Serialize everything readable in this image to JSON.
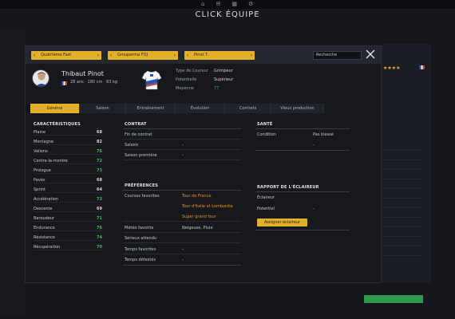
{
  "app": {
    "title": "CLICK ÉQUIPE"
  },
  "top_icons": [
    "home-icon",
    "mail-icon",
    "calendar-icon",
    "settings-icon"
  ],
  "background": {
    "stars": "★★★★"
  },
  "modal": {
    "nav": [
      {
        "label": "Quatrième Fast",
        "name": "nav-prev-team"
      },
      {
        "label": "Grouperma FDJ",
        "name": "nav-team"
      },
      {
        "label": "Pinot T.",
        "name": "nav-rider"
      }
    ],
    "search": {
      "value": "Recherche"
    }
  },
  "rider": {
    "name": "Thibaut Pinot",
    "stats": "28 ans · 180 cm · 63 kg",
    "info": [
      {
        "label": "Type de Coureur",
        "value": "Grimpeur"
      },
      {
        "label": "Potentielle",
        "value": "Supérieur"
      },
      {
        "label": "Moyenne",
        "value": "77"
      }
    ]
  },
  "tabs": [
    {
      "label": "Général",
      "active": true
    },
    {
      "label": "Saison",
      "active": false
    },
    {
      "label": "Entraînement",
      "active": false
    },
    {
      "label": "Évolution",
      "active": false
    },
    {
      "label": "Contrats",
      "active": false
    },
    {
      "label": "Vieux production",
      "active": false
    }
  ],
  "characteristics": {
    "title": "CARACTÉRISTIQUES",
    "items": [
      {
        "name": "Plaine",
        "value": "68",
        "color": "#d6d8dc"
      },
      {
        "name": "Montagne",
        "value": "82",
        "color": "#d6d8dc"
      },
      {
        "name": "Vallons",
        "value": "76",
        "color": "#3fbf5b"
      },
      {
        "name": "Contre-la-montre",
        "value": "72",
        "color": "#3fbf5b"
      },
      {
        "name": "Prologue",
        "value": "73",
        "color": "#3fbf5b"
      },
      {
        "name": "Pavés",
        "value": "68",
        "color": "#d6d8dc"
      },
      {
        "name": "Sprint",
        "value": "64",
        "color": "#d6d8dc"
      },
      {
        "name": "Accélération",
        "value": "73",
        "color": "#3fbf5b"
      },
      {
        "name": "Descente",
        "value": "69",
        "color": "#d6d8dc"
      },
      {
        "name": "Baroudeur",
        "value": "71",
        "color": "#3fbf5b"
      },
      {
        "name": "Endurance",
        "value": "76",
        "color": "#3fbf5b"
      },
      {
        "name": "Résistance",
        "value": "74",
        "color": "#3fbf5b"
      },
      {
        "name": "Récupération",
        "value": "70",
        "color": "#3fbf5b"
      }
    ]
  },
  "contract": {
    "title": "CONTRAT",
    "rows": [
      {
        "label": "Fin de contrat",
        "value": ""
      },
      {
        "label": "Salaire",
        "value": "-"
      },
      {
        "label": "Saison première",
        "value": "-"
      }
    ]
  },
  "preferences": {
    "title": "PRÉFÉRENCES",
    "course_label": "Courses favorites",
    "courses": [
      "Tour de France",
      "Tour d'Italie et Lombardie",
      "Super grand tour"
    ],
    "rows": [
      {
        "label": "Météo favorite",
        "value": "Neigeuse, Pluie"
      },
      {
        "label": "Sérieux attendu",
        "value": ""
      },
      {
        "label": "Temps favorites",
        "value": "-"
      },
      {
        "label": "Temps détestés",
        "value": "-"
      }
    ]
  },
  "health": {
    "title": "SANTÉ",
    "rows": [
      {
        "label": "Condition",
        "value": "Pas blessé"
      },
      {
        "label": "",
        "value": "-"
      }
    ]
  },
  "scout": {
    "title": "RAPPORT DE L'ÉCLAIREUR",
    "rows": [
      {
        "label": "Éclaireur",
        "value": ""
      },
      {
        "label": "Potentiel",
        "value": "-"
      }
    ],
    "button": "Assigner éclaireur"
  }
}
